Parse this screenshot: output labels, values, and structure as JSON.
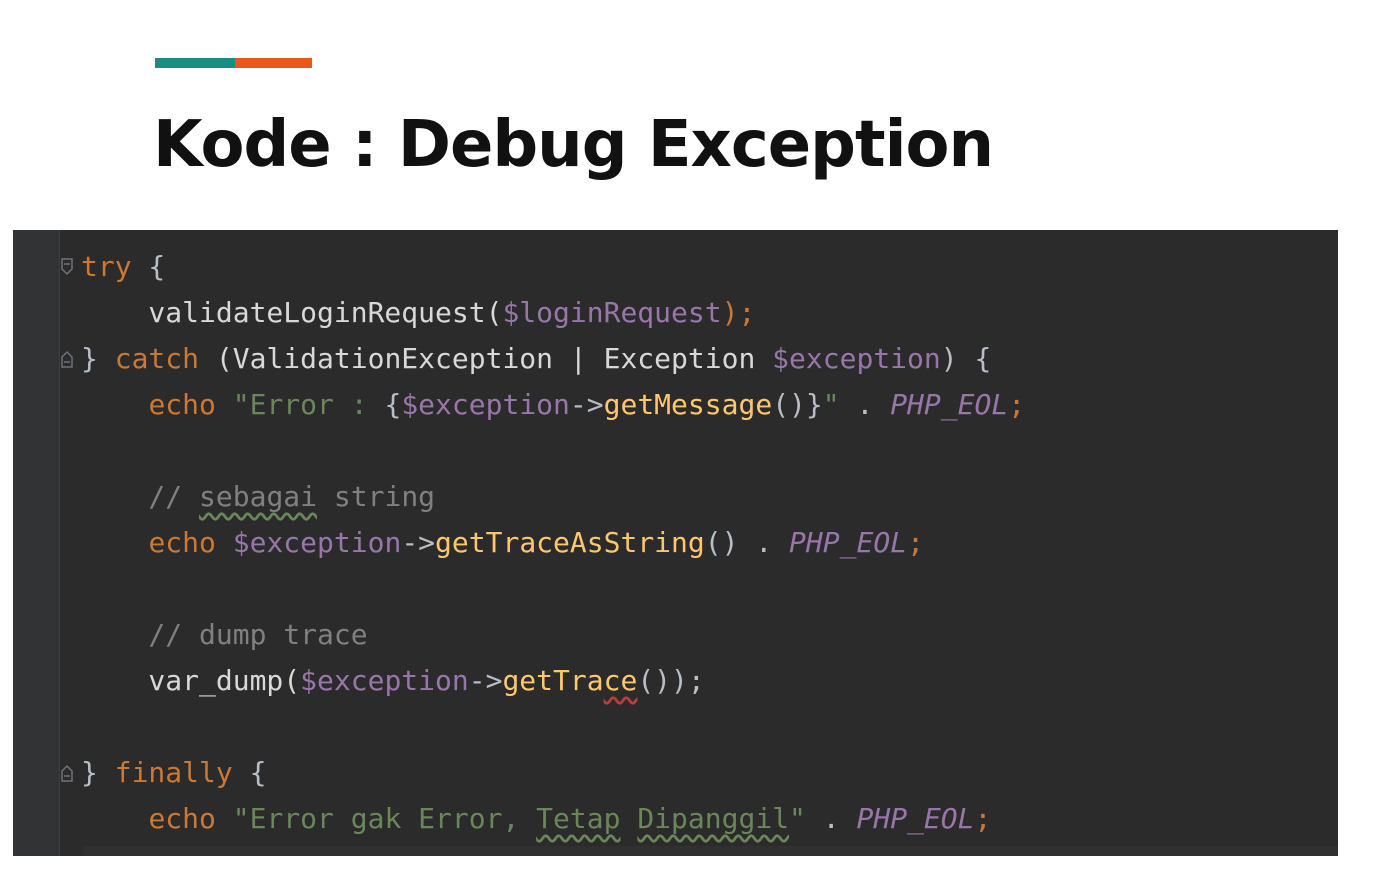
{
  "slide": {
    "title": "Kode : Debug Exception",
    "accent_colors": [
      "#1a8c84",
      "#e8571c"
    ]
  },
  "code_lines": [
    [
      {
        "t": "try",
        "c": "kw"
      },
      {
        "t": " {",
        "c": "punc"
      }
    ],
    [
      {
        "t": "    validateLoginRequest(",
        "c": "fn"
      },
      {
        "t": "$loginRequest",
        "c": "var"
      },
      {
        "t": ");",
        "c": "kw"
      }
    ],
    [
      {
        "t": "} ",
        "c": "punc"
      },
      {
        "t": "catch",
        "c": "kw"
      },
      {
        "t": " (ValidationException | Exception ",
        "c": "fn"
      },
      {
        "t": "$exception",
        "c": "var"
      },
      {
        "t": ") {",
        "c": "punc"
      }
    ],
    [
      {
        "t": "    ",
        "c": "fn"
      },
      {
        "t": "echo",
        "c": "kw"
      },
      {
        "t": " \"Error : ",
        "c": "str"
      },
      {
        "t": "{",
        "c": "punc"
      },
      {
        "t": "$exception",
        "c": "var"
      },
      {
        "t": "->",
        "c": "punc"
      },
      {
        "t": "getMessage",
        "c": "method"
      },
      {
        "t": "()}",
        "c": "punc"
      },
      {
        "t": "\"",
        "c": "str"
      },
      {
        "t": " . ",
        "c": "punc"
      },
      {
        "t": "PHP_EOL",
        "c": "const"
      },
      {
        "t": ";",
        "c": "kw"
      }
    ],
    [],
    [
      {
        "t": "    // ",
        "c": "comment"
      },
      {
        "t": "sebagai",
        "c": "comment",
        "u": "typo"
      },
      {
        "t": " string",
        "c": "comment"
      }
    ],
    [
      {
        "t": "    ",
        "c": "fn"
      },
      {
        "t": "echo",
        "c": "kw"
      },
      {
        "t": " ",
        "c": "fn"
      },
      {
        "t": "$exception",
        "c": "var"
      },
      {
        "t": "->",
        "c": "punc"
      },
      {
        "t": "getTraceAsString",
        "c": "method"
      },
      {
        "t": "() . ",
        "c": "punc"
      },
      {
        "t": "PHP_EOL",
        "c": "const"
      },
      {
        "t": ";",
        "c": "kw"
      }
    ],
    [],
    [
      {
        "t": "    // dump trace",
        "c": "comment"
      }
    ],
    [
      {
        "t": "    var_dump(",
        "c": "fn"
      },
      {
        "t": "$exception",
        "c": "var"
      },
      {
        "t": "->",
        "c": "punc"
      },
      {
        "t": "getTra",
        "c": "method"
      },
      {
        "t": "ce",
        "c": "method",
        "u": "err"
      },
      {
        "t": "());",
        "c": "punc"
      }
    ],
    [],
    [
      {
        "t": "} ",
        "c": "punc"
      },
      {
        "t": "finally",
        "c": "kw"
      },
      {
        "t": " {",
        "c": "punc"
      }
    ],
    [
      {
        "t": "    ",
        "c": "fn"
      },
      {
        "t": "echo",
        "c": "kw"
      },
      {
        "t": " \"Error gak Error, ",
        "c": "str"
      },
      {
        "t": "Tetap",
        "c": "str",
        "u": "typo"
      },
      {
        "t": " ",
        "c": "str"
      },
      {
        "t": "Dipanggil",
        "c": "str",
        "u": "typo"
      },
      {
        "t": "\"",
        "c": "str"
      },
      {
        "t": " . ",
        "c": "punc"
      },
      {
        "t": "PHP_EOL",
        "c": "const"
      },
      {
        "t": ";",
        "c": "kw"
      }
    ]
  ],
  "folds": [
    {
      "line": 0,
      "shape": "fold-open-icon"
    },
    {
      "line": 2,
      "shape": "fold-close-icon"
    },
    {
      "line": 11,
      "shape": "fold-close-icon"
    }
  ]
}
